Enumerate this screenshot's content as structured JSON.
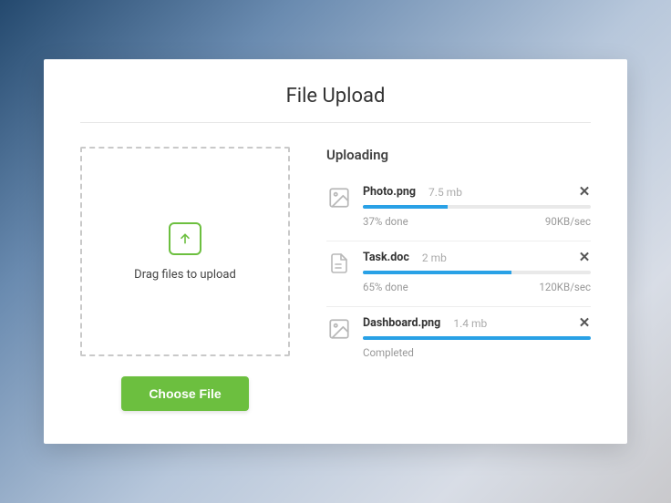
{
  "title": "File Upload",
  "dropzone": {
    "label": "Drag files to upload",
    "button": "Choose File"
  },
  "uploads": {
    "heading": "Uploading",
    "items": [
      {
        "icon": "image",
        "name": "Photo.png",
        "size": "7.5 mb",
        "progress": 37,
        "status": "37% done",
        "rate": "90KB/sec"
      },
      {
        "icon": "doc",
        "name": "Task.doc",
        "size": "2 mb",
        "progress": 65,
        "status": "65% done",
        "rate": "120KB/sec"
      },
      {
        "icon": "image",
        "name": "Dashboard.png",
        "size": "1.4 mb",
        "progress": 100,
        "status": "Completed",
        "rate": ""
      }
    ]
  }
}
